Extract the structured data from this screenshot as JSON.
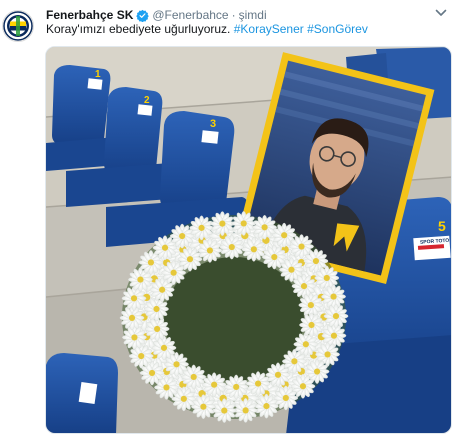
{
  "tweet": {
    "display_name": "Fenerbahçe SK",
    "handle": "@Fenerbahce",
    "separator": "·",
    "timestamp": "şimdi",
    "text_main": "Koray'ımızı ebediyete uğurluyoruz.",
    "hashtags": [
      "#KoraySener",
      "#SonGörev"
    ]
  },
  "photo": {
    "seat_numbers": [
      "1",
      "2",
      "3",
      "5"
    ],
    "sponsor_sticker": "SPOR TOTO"
  },
  "icons": {
    "verified": "verified-badge-icon",
    "caret": "chevron-down-icon"
  },
  "colors": {
    "hashtag": "#1b95e0",
    "verified": "#1da1f2",
    "seat_blue": "#1d4f9e",
    "frame_yellow": "#f3c318",
    "club_navy": "#0a2a5c",
    "club_yellow": "#ffd200"
  }
}
